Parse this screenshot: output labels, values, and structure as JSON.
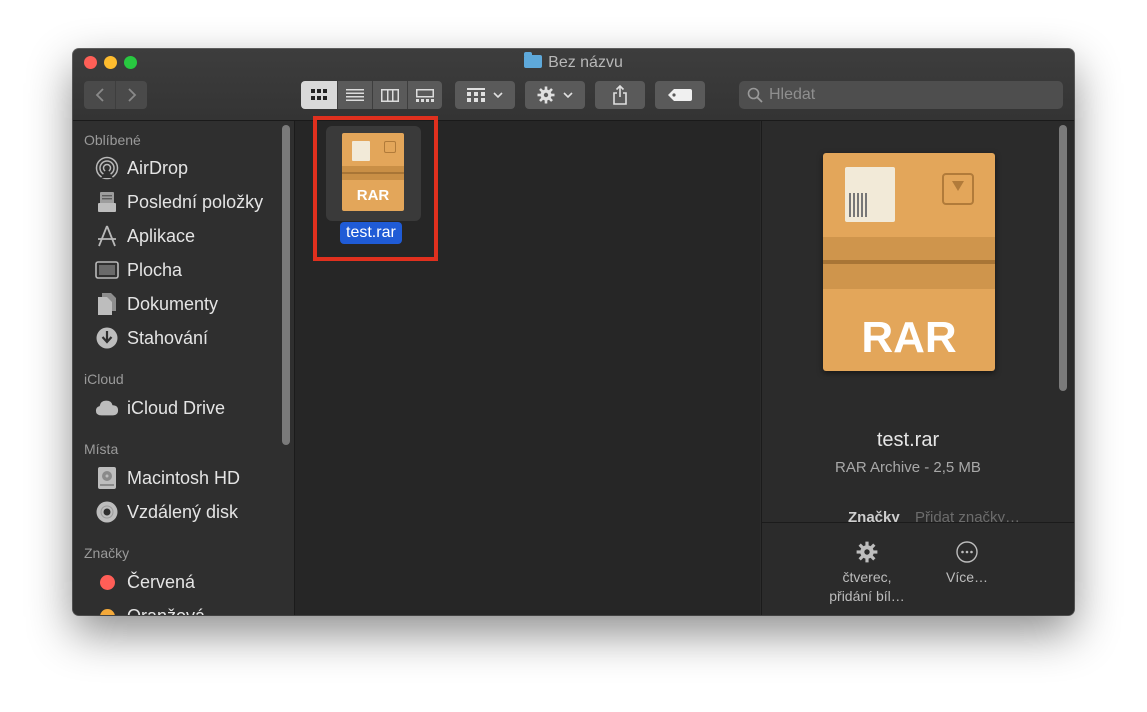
{
  "window": {
    "title": "Bez názvu"
  },
  "toolbar": {
    "back_icon": "chevron-left-icon",
    "forward_icon": "chevron-right-icon",
    "views": [
      "icon-view",
      "list-view",
      "column-view",
      "gallery-view"
    ],
    "search": {
      "placeholder": "Hledat"
    }
  },
  "sidebar": {
    "sections": [
      {
        "header": "Oblíbené",
        "items": [
          {
            "label": "AirDrop",
            "icon": "airdrop-icon"
          },
          {
            "label": "Poslední položky",
            "icon": "recents-icon"
          },
          {
            "label": "Aplikace",
            "icon": "applications-icon"
          },
          {
            "label": "Plocha",
            "icon": "desktop-icon"
          },
          {
            "label": "Dokumenty",
            "icon": "documents-icon"
          },
          {
            "label": "Stahování",
            "icon": "downloads-icon"
          }
        ]
      },
      {
        "header": "iCloud",
        "items": [
          {
            "label": "iCloud Drive",
            "icon": "cloud-icon"
          }
        ]
      },
      {
        "header": "Místa",
        "items": [
          {
            "label": "Macintosh HD",
            "icon": "hard-drive-icon"
          },
          {
            "label": "Vzdálený disk",
            "icon": "disc-icon"
          }
        ]
      },
      {
        "header": "Značky",
        "items": [
          {
            "label": "Červená",
            "color": "#ff5e57"
          },
          {
            "label": "Oranžová",
            "color": "#f4a93a"
          }
        ]
      }
    ]
  },
  "content": {
    "files": [
      {
        "name": "test.rar",
        "icon_text": "RAR",
        "selected": true
      }
    ]
  },
  "preview": {
    "icon_text": "RAR",
    "name": "test.rar",
    "kind": "RAR Archive - 2,5 MB",
    "tags_label": "Značky",
    "tags_placeholder": "Přidat značky…",
    "actions": [
      {
        "label": "čtverec,\npřidání bíl…",
        "icon": "gear-icon"
      },
      {
        "label": "Více…",
        "icon": "more-icon"
      }
    ]
  },
  "colors": {
    "selection": "#1f5bd6",
    "highlight_box": "#e0301e",
    "archive": "#e3a65a"
  }
}
